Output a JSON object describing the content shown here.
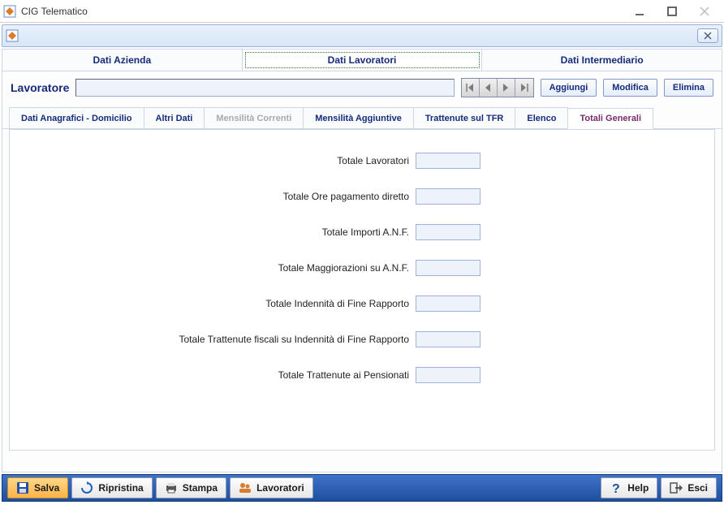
{
  "window": {
    "title": "CIG Telematico"
  },
  "top_tabs": {
    "azienda": "Dati Azienda",
    "lavoratori": "Dati Lavoratori",
    "intermediario": "Dati Intermediario"
  },
  "worker": {
    "label": "Lavoratore",
    "value": "",
    "aggiungi": "Aggiungi",
    "modifica": "Modifica",
    "elimina": "Elimina"
  },
  "subtabs": {
    "anagrafici": "Dati Anagrafici - Domicilio",
    "altri": "Altri Dati",
    "mens_corr": "Mensilità Correnti",
    "mens_agg": "Mensilità Aggiuntive",
    "trattenute": "Trattenute sul TFR",
    "elenco": "Elenco",
    "totali": "Totali Generali"
  },
  "fields": {
    "lavoratori": {
      "label": "Totale Lavoratori",
      "value": ""
    },
    "ore": {
      "label": "Totale Ore pagamento diretto",
      "value": ""
    },
    "importi_anf": {
      "label": "Totale Importi A.N.F.",
      "value": ""
    },
    "magg_anf": {
      "label": "Totale Maggiorazioni su A.N.F.",
      "value": ""
    },
    "ind_fine": {
      "label": "Totale Indennità di Fine Rapporto",
      "value": ""
    },
    "tratt_fisc": {
      "label": "Totale Trattenute fiscali su Indennità di Fine Rapporto",
      "value": ""
    },
    "tratt_pens": {
      "label": "Totale Trattenute ai Pensionati",
      "value": ""
    }
  },
  "toolbar": {
    "salva": "Salva",
    "ripristina": "Ripristina",
    "stampa": "Stampa",
    "lavoratori": "Lavoratori",
    "help": "Help",
    "esci": "Esci"
  }
}
